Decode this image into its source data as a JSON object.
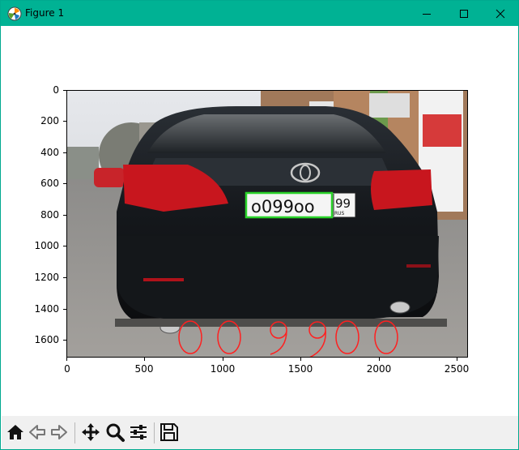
{
  "window": {
    "title": "Figure 1",
    "accent_color": "#00b294"
  },
  "plot": {
    "x_ticks": [
      "0",
      "500",
      "1000",
      "1500",
      "2000",
      "2500"
    ],
    "y_ticks": [
      "0",
      "200",
      "400",
      "600",
      "800",
      "1000",
      "1200",
      "1400",
      "1600"
    ],
    "image_content": {
      "plate_text": "о099оо",
      "plate_region": "99",
      "plate_country": "RUS",
      "plate_box_color": "#2ad32a",
      "recognized_digits_color": "#ff2020"
    }
  },
  "toolbar": {
    "buttons": [
      "home-icon",
      "back-icon",
      "forward-icon",
      "pan-icon",
      "zoom-icon",
      "configure-subplots-icon",
      "save-icon"
    ]
  }
}
